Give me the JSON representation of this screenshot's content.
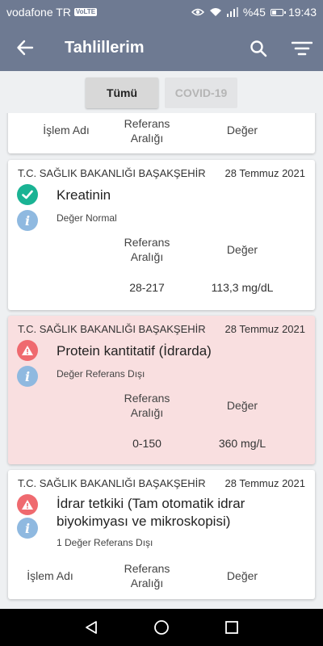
{
  "status_bar": {
    "carrier": "vodafone TR",
    "volte_badge": "VoLTE",
    "battery_label": "%45",
    "battery_level": 0.45,
    "time": "19:43"
  },
  "app_bar": {
    "title": "Tahlillerim"
  },
  "tabs": [
    {
      "label": "Tümü",
      "active": true
    },
    {
      "label": "COVID-19",
      "active": false
    }
  ],
  "partial_card": {
    "col_name": "İşlem Adı",
    "col_range_1": "Referans",
    "col_range_2": "Aralığı",
    "col_value": "Değer"
  },
  "results": [
    {
      "institution": "T.C. SAĞLIK BAKANLIĞI BAŞAKŞEHİR",
      "date": "28 Temmuz 2021",
      "status": "normal",
      "test_name": "Kreatinin",
      "status_text": "Değer Normal",
      "col_range_1": "Referans",
      "col_range_2": "Aralığı",
      "col_value": "Değer",
      "range": "28-217",
      "value": "113,3 mg/dL"
    },
    {
      "institution": "T.C. SAĞLIK BAKANLIĞI BAŞAKŞEHİR",
      "date": "28 Temmuz 2021",
      "status": "out_of_range",
      "test_name": "Protein kantitatif (İdrarda)",
      "status_text": "Değer Referans Dışı",
      "col_range_1": "Referans",
      "col_range_2": "Aralığı",
      "col_value": "Değer",
      "range": "0-150",
      "value": "360 mg/L"
    },
    {
      "institution": "T.C. SAĞLIK BAKANLIĞI BAŞAKŞEHİR",
      "date": "28 Temmuz 2021",
      "status": "out_of_range",
      "test_name_line1": "İdrar tetkiki (Tam otomatik idrar",
      "test_name_line2": "biyokimyası ve mikroskopisi)",
      "status_text": "1 Değer Referans Dışı",
      "col_name": "İşlem Adı",
      "col_range_1": "Referans",
      "col_range_2": "Aralığı",
      "col_value": "Değer"
    }
  ],
  "colors": {
    "app_bar": "#6e7a92",
    "ok": "#1ab394",
    "alert": "#ef6a6f",
    "info": "#8fb9e0",
    "alert_card_bg": "#f9dfe0"
  }
}
